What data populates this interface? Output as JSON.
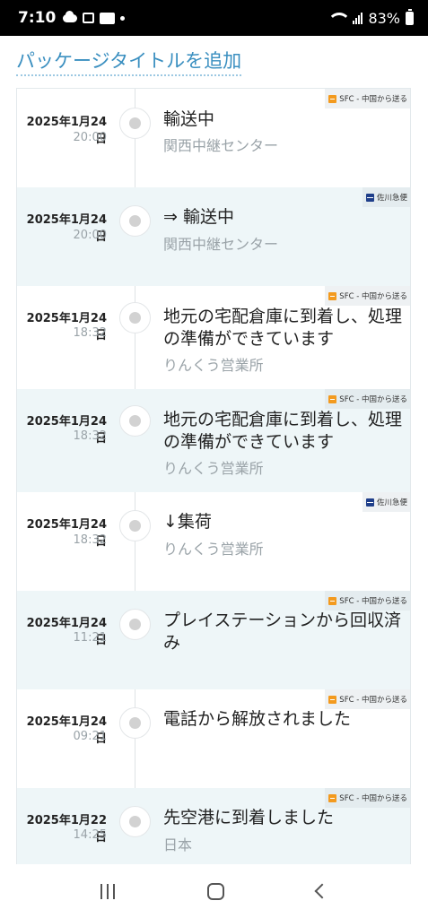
{
  "status_bar": {
    "time": "7:10",
    "battery": "83%"
  },
  "header": {
    "add_title": "パッケージタイトルを追加"
  },
  "events": [
    {
      "date": "2025年1月24日",
      "time": "20:00",
      "title": "輸送中",
      "location": "関西中継センター",
      "carrier": "SFC - 中国から送る",
      "carrier_icon": "sfc-icon"
    },
    {
      "date": "2025年1月24日",
      "time": "20:00",
      "title": "⇒ 輸送中",
      "location": "関西中継センター",
      "carrier": "佐川急便",
      "carrier_icon": "sagawa-icon"
    },
    {
      "date": "2025年1月24日",
      "time": "18:32",
      "title": "地元の宅配倉庫に到着し、処理の準備ができています",
      "location": "りんくう営業所",
      "carrier": "SFC - 中国から送る",
      "carrier_icon": "sfc-icon"
    },
    {
      "date": "2025年1月24日",
      "time": "18:32",
      "title": "地元の宅配倉庫に到着し、処理の準備ができています",
      "location": "りんくう営業所",
      "carrier": "SFC - 中国から送る",
      "carrier_icon": "sfc-icon"
    },
    {
      "date": "2025年1月24日",
      "time": "18:32",
      "title": "↓集荷",
      "location": "りんくう営業所",
      "carrier": "佐川急便",
      "carrier_icon": "sagawa-icon"
    },
    {
      "date": "2025年1月24日",
      "time": "11:21",
      "title": "プレイステーションから回収済み",
      "location": "",
      "carrier": "SFC - 中国から送る",
      "carrier_icon": "sfc-icon"
    },
    {
      "date": "2025年1月24日",
      "time": "09:21",
      "title": "電話から解放されました",
      "location": "",
      "carrier": "SFC - 中国から送る",
      "carrier_icon": "sfc-icon"
    },
    {
      "date": "2025年1月22日",
      "time": "14:25",
      "title": "先空港に到着しました",
      "location": "日本",
      "carrier": "SFC - 中国から送る",
      "carrier_icon": "sfc-icon"
    }
  ],
  "colors": {
    "accent": "#3a8fc0",
    "alt_row": "#eef6f8",
    "sfc": "#f39a1e",
    "sagawa": "#1f3f8a"
  }
}
